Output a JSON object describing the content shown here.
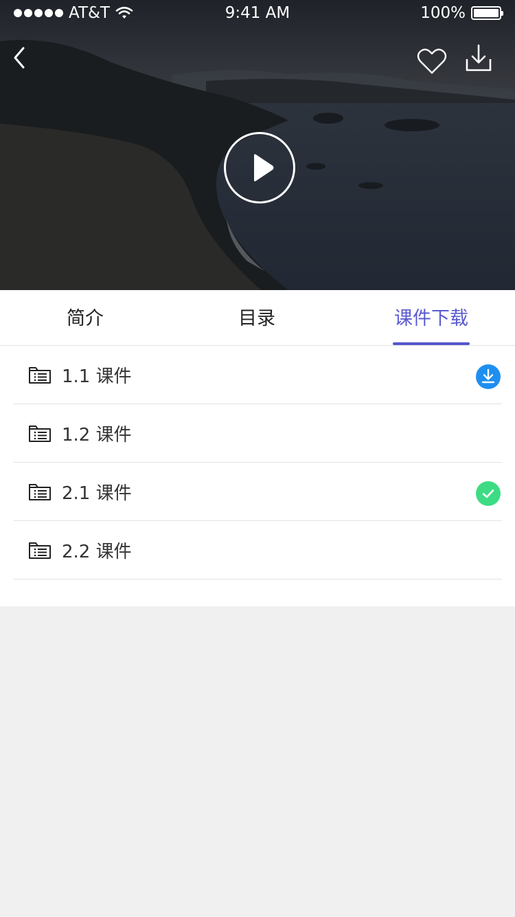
{
  "status_bar": {
    "carrier": "AT&T",
    "time": "9:41 AM",
    "battery": "100%"
  },
  "video": {
    "icons": {
      "back": "chevron-left-icon",
      "favorite": "heart-outline-icon",
      "download": "download-tray-icon",
      "play": "play-icon"
    }
  },
  "tabs": [
    {
      "label": "简介",
      "active": false
    },
    {
      "label": "目录",
      "active": false
    },
    {
      "label": "课件下载",
      "active": true
    }
  ],
  "courseware": [
    {
      "title": "1.1 课件",
      "status": "downloadable"
    },
    {
      "title": "1.2 课件",
      "status": "none"
    },
    {
      "title": "2.1 课件",
      "status": "downloaded"
    },
    {
      "title": "2.2 课件",
      "status": "none"
    }
  ],
  "colors": {
    "accent": "#5656cc",
    "download_blue": "#1e8ff0",
    "done_green": "#3ddc84",
    "background": "#f0f0f0"
  }
}
